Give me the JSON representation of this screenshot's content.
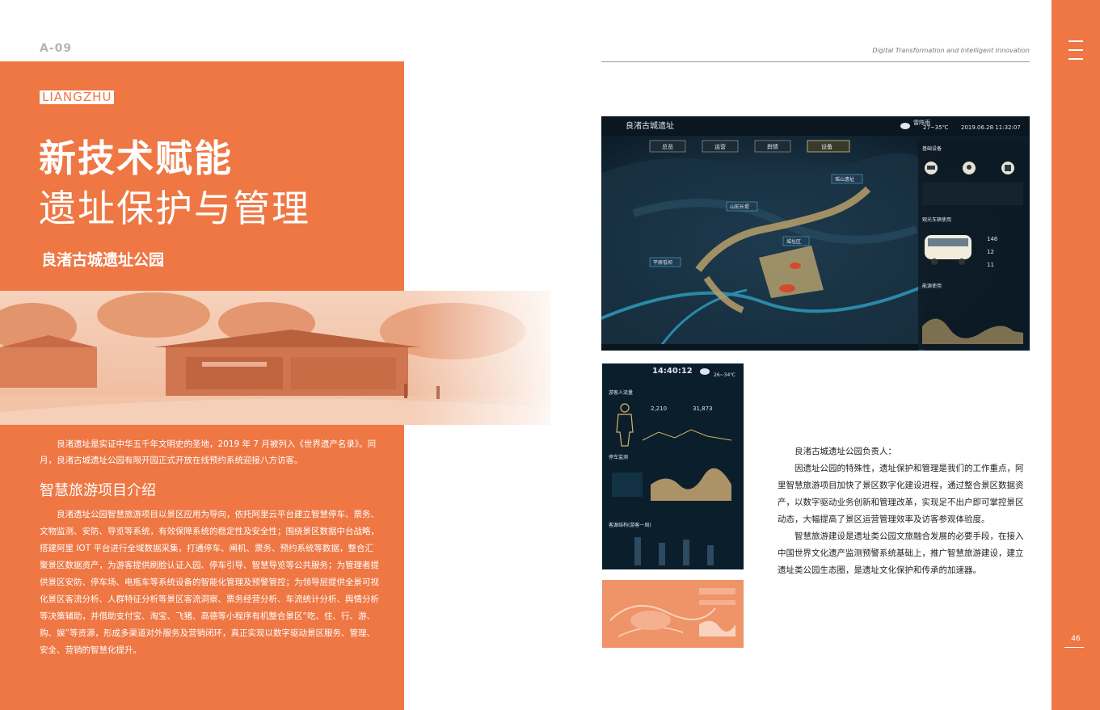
{
  "header": {
    "page_code": "A-09",
    "tagline": "Digital Transformation and Intelligent Innovation"
  },
  "hero": {
    "tag": "LIANGZHU",
    "title_line1": "新技术赋能",
    "title_line2": "遗址保护与管理",
    "subtitle": "良渚古城遗址公园"
  },
  "intro": {
    "text": "良渚遗址是实证中华五千年文明史的圣地，2019 年 7 月被列入《世界遗产名录》。同月，良渚古城遗址公园有限开园正式开放在线预约系统迎接八方访客。"
  },
  "section": {
    "title": "智慧旅游项目介绍",
    "body": "良渚遗址公园智慧旅游项目以景区应用为导向，依托阿里云平台建立智慧停车、票务、文物监测、安防、导览等系统，有效保障系统的稳定性及安全性；围绕景区数据中台战略，搭建阿里 IOT 平台进行全域数据采集，打通停车、闸机、票务、预约系统等数据，整合汇聚景区数据资产，为游客提供刷脸认证入园、停车引导、智慧导览等公共服务；为管理者提供景区安防、停车场、电瓶车等系统设备的智能化管理及预警管控；为领导层提供全景可视化景区客流分析、人群特征分析等景区客流洞察、票务经营分析、车流统计分析、舆情分析等决策辅助，并借助支付宝、淘宝、飞猪、高德等小程序有机整合景区“吃、住、行、游、购、娱”等资源，形成多渠道对外服务及营销闭环，真正实现以数字驱动景区服务、管理、安全、营销的智慧化提升。"
  },
  "right_text": {
    "lead": "良渚古城遗址公园负责人：",
    "p1": "因遗址公园的特殊性，遗址保护和管理是我们的工作重点，阿里智慧旅游项目加快了景区数字化建设进程，通过整合景区数据资产，以数字驱动业务创新和管理改革，实现足不出户即可掌控景区动态，大幅提高了景区运营管理效率及访客参观体验度。",
    "p2": "智慧旅游建设是遗址类公园文旅融合发展的必要手段，在接入中国世界文化遗产监测预警系统基础上，推广智慧旅游建设，建立遗址类公园生态圈，是遗址文化保护和传承的加速器。"
  },
  "page_number": "46",
  "dashboard_main": {
    "logo_text": "良渚古城遗址",
    "weather": "雷阵雨",
    "temperature": "27~35℃",
    "datetime": "2019.06.28 11:32:07",
    "tabs": [
      "总览",
      "运营",
      "舆情",
      "设备"
    ],
    "map_labels": [
      "瑶山遗址",
      "山前长堤",
      "城址区",
      "平原低坝"
    ],
    "side_labels": [
      "基础设备",
      "观光车辆使用",
      "能源使用"
    ],
    "vehicle_stats": [
      "146",
      "12",
      "11"
    ]
  },
  "dashboard_mobile": {
    "time": "14:40:12",
    "temperature": "26~34℃",
    "section_visitors": "游客人流量",
    "today_count": "2,210",
    "history_count": "31,873",
    "section_parking": "停车监测",
    "section_source": "客源结构(游客一周)"
  },
  "colors": {
    "accent": "#ee7744",
    "dashboard_bg": "#0e2233"
  },
  "icons": [
    "menu-icon",
    "weather-cloud-icon",
    "car-icon",
    "bulb-icon",
    "bus-icon"
  ]
}
